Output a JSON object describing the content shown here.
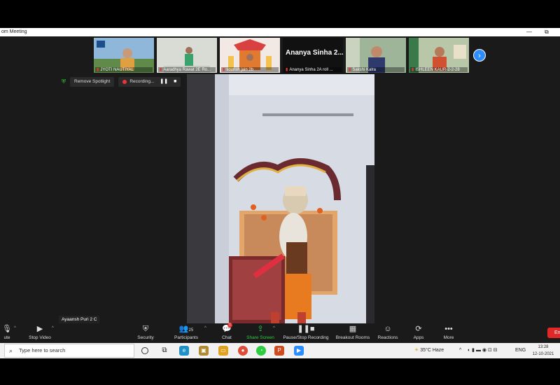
{
  "window": {
    "title": "om Meeting",
    "minimize": "—",
    "maximize": "⧉"
  },
  "thumbnails": [
    {
      "label": "JYOTI NAUTIYAL"
    },
    {
      "label": "Aaradhya Rawat 2E Ro..."
    },
    {
      "label": "sourish jain 2b"
    },
    {
      "label": "Ananya Sinha 2A roll ...",
      "big_name": "Ananya Sinha 2..."
    },
    {
      "label": "Sakshi Kalra"
    },
    {
      "label": "ISHLEEN KAUR-2-2-28"
    }
  ],
  "next_page": "›",
  "spotlight": {
    "remove_label": "Remove Spotlight",
    "recording_label": "Recording...",
    "pause": "❚❚",
    "stop": "■"
  },
  "self_view": {
    "label": "Ayaansh Puri 2 C"
  },
  "toolbar": {
    "mute": "ute",
    "stop_video": "Stop Video",
    "security": "Security",
    "participants": "Participants",
    "participants_count": "25",
    "chat": "Chat",
    "chat_badge": "1",
    "share_screen": "Share Screen",
    "pause_stop_recording": "Pause/Stop Recording",
    "breakout_rooms": "Breakout Rooms",
    "reactions": "Reactions",
    "apps": "Apps",
    "more": "More",
    "end": "End"
  },
  "taskbar": {
    "search_placeholder": "Type here to search",
    "weather": "35°C Haze",
    "lang": "ENG",
    "time": "13:28",
    "date": "12-10-2021"
  },
  "colors": {
    "accent": "#2d8cff",
    "end": "#e02828",
    "green": "#2ecc40"
  }
}
